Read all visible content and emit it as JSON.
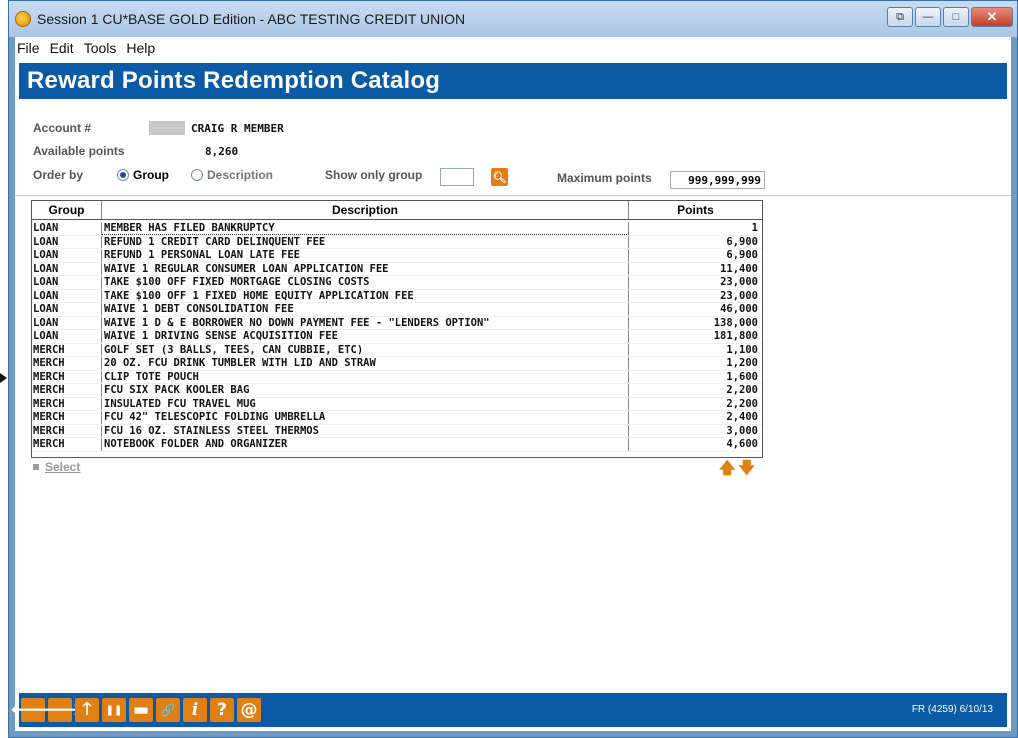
{
  "window": {
    "title": "Session 1 CU*BASE GOLD Edition - ABC TESTING CREDIT UNION",
    "buttons": {
      "restore": "⧉",
      "minimize": "—",
      "maximize": "□",
      "close": "✕"
    }
  },
  "menu": [
    "File",
    "Edit",
    "Tools",
    "Help"
  ],
  "header": {
    "title": "Reward Points Redemption Catalog"
  },
  "form": {
    "account_label": "Account #",
    "account_name": "CRAIG R MEMBER",
    "available_label": "Available points",
    "available_value": "8,260",
    "order_by_label": "Order by",
    "order_group": "Group",
    "order_description": "Description",
    "order_selected": "Group",
    "show_only_group_label": "Show only group",
    "show_only_group_value": "",
    "maximum_points_label": "Maximum points",
    "maximum_points_value": "999,999,999"
  },
  "table": {
    "headers": {
      "group": "Group",
      "description": "Description",
      "points": "Points"
    },
    "rows": [
      {
        "group": "LOAN",
        "description": "MEMBER HAS FILED BANKRUPTCY",
        "points": "1"
      },
      {
        "group": "LOAN",
        "description": "REFUND 1 CREDIT CARD DELINQUENT FEE",
        "points": "6,900"
      },
      {
        "group": "LOAN",
        "description": "REFUND 1 PERSONAL LOAN LATE FEE",
        "points": "6,900"
      },
      {
        "group": "LOAN",
        "description": "WAIVE 1 REGULAR CONSUMER LOAN APPLICATION FEE",
        "points": "11,400"
      },
      {
        "group": "LOAN",
        "description": "TAKE $100 OFF FIXED MORTGAGE CLOSING COSTS",
        "points": "23,000"
      },
      {
        "group": "LOAN",
        "description": "TAKE $100 OFF 1 FIXED HOME EQUITY APPLICATION FEE",
        "points": "23,000"
      },
      {
        "group": "LOAN",
        "description": "WAIVE 1 DEBT CONSOLIDATION FEE",
        "points": "46,000"
      },
      {
        "group": "LOAN",
        "description": "WAIVE 1 D & E BORROWER NO DOWN PAYMENT FEE - \"LENDERS OPTION\"",
        "points": "138,000"
      },
      {
        "group": "LOAN",
        "description": "WAIVE 1 DRIVING SENSE ACQUISITION FEE",
        "points": "181,800"
      },
      {
        "group": "MERCH",
        "description": "GOLF SET (3 BALLS, TEES, CAN CUBBIE, ETC)",
        "points": "1,100"
      },
      {
        "group": "MERCH",
        "description": "20 OZ. FCU DRINK TUMBLER WITH LID AND STRAW",
        "points": "1,200"
      },
      {
        "group": "MERCH",
        "description": "CLIP TOTE POUCH",
        "points": "1,600"
      },
      {
        "group": "MERCH",
        "description": "FCU SIX PACK KOOLER BAG",
        "points": "2,200"
      },
      {
        "group": "MERCH",
        "description": "INSULATED FCU TRAVEL MUG",
        "points": "2,200"
      },
      {
        "group": "MERCH",
        "description": "FCU 42\" TELESCOPIC FOLDING UMBRELLA",
        "points": "2,400"
      },
      {
        "group": "MERCH",
        "description": "FCU 16 OZ. STAINLESS STEEL THERMOS",
        "points": "3,000"
      },
      {
        "group": "MERCH",
        "description": "NOTEBOOK FOLDER AND ORGANIZER",
        "points": "4,600"
      }
    ]
  },
  "actions": {
    "select_label": "Select",
    "scroll_up": "🡅",
    "scroll_down": "🡇"
  },
  "toolbar": {
    "buttons": [
      {
        "name": "back-icon",
        "glyph": "🡐"
      },
      {
        "name": "forward-icon",
        "glyph": "🡒"
      },
      {
        "name": "up-icon",
        "glyph": "🡑"
      },
      {
        "name": "pause-icon",
        "glyph": "❚❚"
      },
      {
        "name": "print-icon",
        "glyph": "▬"
      },
      {
        "name": "link-icon",
        "glyph": "🔗"
      },
      {
        "name": "info-icon",
        "glyph": "i"
      },
      {
        "name": "help-icon",
        "glyph": "?"
      },
      {
        "name": "email-icon",
        "glyph": "@"
      }
    ]
  },
  "footer": {
    "code": "FR (4259) 6/10/13"
  },
  "colors": {
    "header_band": "#0a5aa6",
    "accent": "#e07f12"
  }
}
